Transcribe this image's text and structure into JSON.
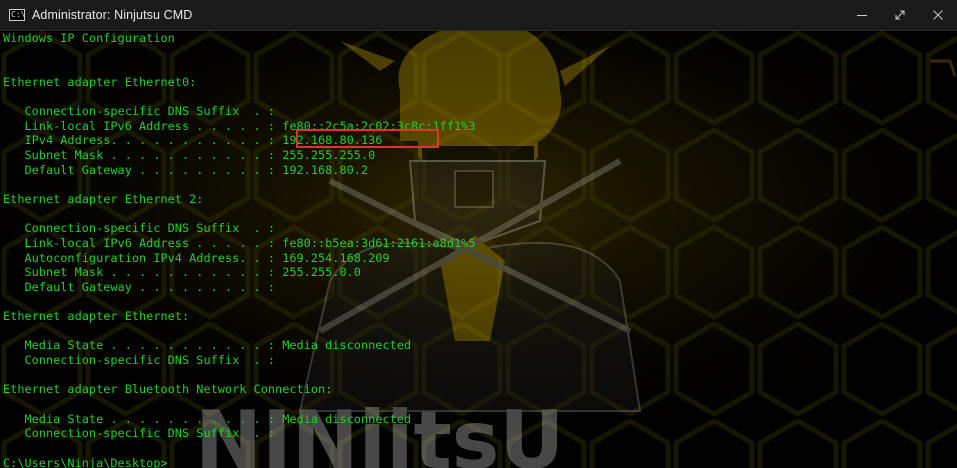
{
  "window": {
    "title": "Administrator: Ninjutsu CMD",
    "app_icon_text": "C:\\",
    "controls": [
      "minimize-icon",
      "maximize-icon",
      "close-icon"
    ]
  },
  "background": {
    "logo_text": "NINjitsU",
    "accent_color": "#e6b400",
    "text_color": "#1fd12a",
    "highlight_color": "#e2322e"
  },
  "console": {
    "lines": [
      "Windows IP Configuration",
      "",
      "",
      "Ethernet adapter Ethernet0:",
      "",
      "   Connection-specific DNS Suffix  . :",
      "   Link-local IPv6 Address . . . . . : fe80::2c5a:2c02:3c8c:1ff1%3",
      "   IPv4 Address. . . . . . . . . . . : 192.168.80.136",
      "   Subnet Mask . . . . . . . . . . . : 255.255.255.0",
      "   Default Gateway . . . . . . . . . : 192.168.80.2",
      "",
      "Ethernet adapter Ethernet 2:",
      "",
      "   Connection-specific DNS Suffix  . :",
      "   Link-local IPv6 Address . . . . . : fe80::b5ea:3d61:2161:a8d1%5",
      "   Autoconfiguration IPv4 Address. . : 169.254.168.209",
      "   Subnet Mask . . . . . . . . . . . : 255.255.0.0",
      "   Default Gateway . . . . . . . . . :",
      "",
      "Ethernet adapter Ethernet:",
      "",
      "   Media State . . . . . . . . . . . : Media disconnected",
      "   Connection-specific DNS Suffix  . :",
      "",
      "Ethernet adapter Bluetooth Network Connection:",
      "",
      "   Media State . . . . . . . . . . . : Media disconnected",
      "   Connection-specific DNS Suffix  . :",
      "",
      "C:\\Users\\Ninja\\Desktop>"
    ]
  }
}
